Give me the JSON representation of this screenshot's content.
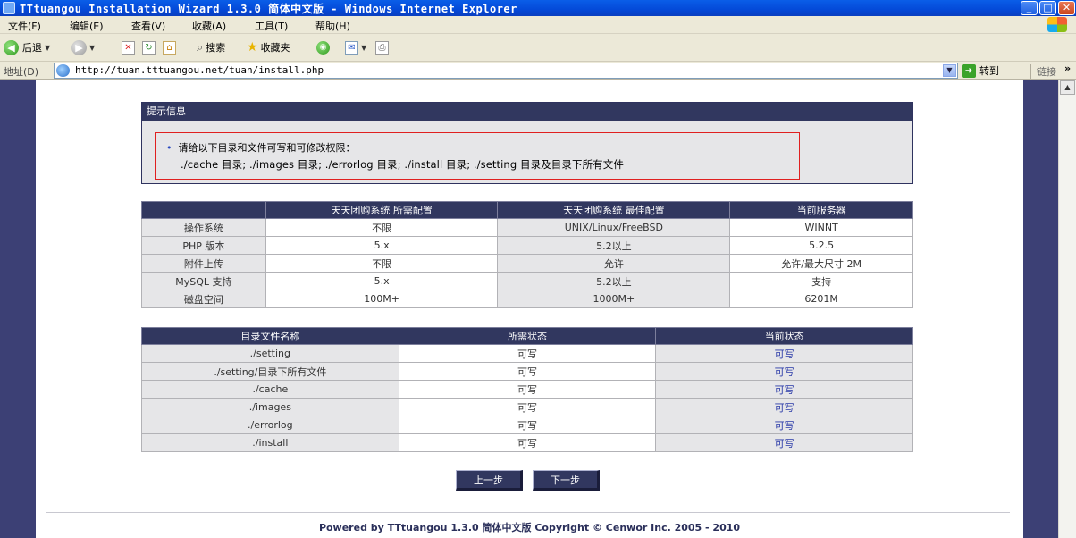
{
  "window": {
    "title": "TTtuangou Installation Wizard 1.3.0 简体中文版 - Windows Internet Explorer",
    "min": "_",
    "max": "□",
    "close": "✕"
  },
  "menu": [
    "文件(F)",
    "编辑(E)",
    "查看(V)",
    "收藏(A)",
    "工具(T)",
    "帮助(H)"
  ],
  "toolbar": {
    "back": "后退",
    "search": "搜索",
    "favorites": "收藏夹"
  },
  "address": {
    "label": "地址(D)",
    "url": "http://tuan.tttuangou.net/tuan/install.php",
    "go": "转到",
    "links": "链接"
  },
  "notice": {
    "header": "提示信息",
    "line1": "请给以下目录和文件可写和可修改权限：",
    "line2": "./cache 目录;    ./images 目录;    ./errorlog 目录;    ./install 目录;    ./setting 目录及目录下所有文件"
  },
  "config_table": {
    "headers": [
      "",
      "天天团购系统 所需配置",
      "天天团购系统 最佳配置",
      "当前服务器"
    ],
    "rows": [
      [
        "操作系统",
        "不限",
        "UNIX/Linux/FreeBSD",
        "WINNT"
      ],
      [
        "PHP 版本",
        "5.x",
        "5.2以上",
        "5.2.5"
      ],
      [
        "附件上传",
        "不限",
        "允许",
        "允许/最大尺寸 2M"
      ],
      [
        "MySQL 支持",
        "5.x",
        "5.2以上",
        "支持"
      ],
      [
        "磁盘空间",
        "100M+",
        "1000M+",
        "6201M"
      ]
    ]
  },
  "perm_table": {
    "headers": [
      "目录文件名称",
      "所需状态",
      "当前状态"
    ],
    "rows": [
      [
        "./setting",
        "可写",
        "可写"
      ],
      [
        "./setting/目录下所有文件",
        "可写",
        "可写"
      ],
      [
        "./cache",
        "可写",
        "可写"
      ],
      [
        "./images",
        "可写",
        "可写"
      ],
      [
        "./errorlog",
        "可写",
        "可写"
      ],
      [
        "./install",
        "可写",
        "可写"
      ]
    ]
  },
  "buttons": {
    "prev": "上一步",
    "next": "下一步"
  },
  "footer": "Powered by TTtuangou 1.3.0 简体中文版  Copyright © Cenwor Inc. 2005 - 2010"
}
